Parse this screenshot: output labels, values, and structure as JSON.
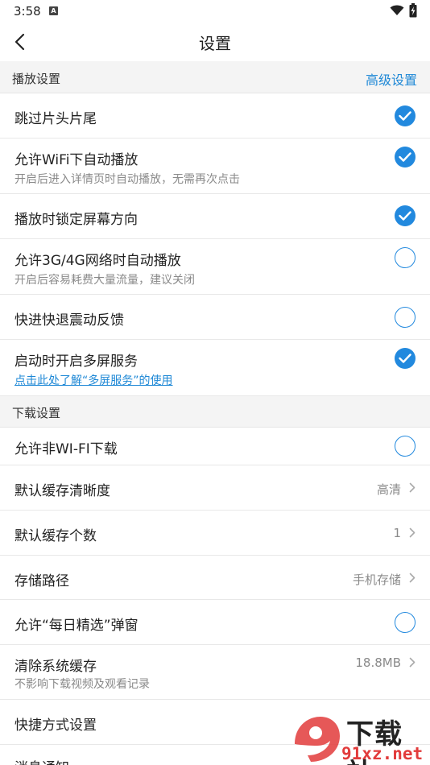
{
  "status": {
    "time": "3:58",
    "notif_letter": "A"
  },
  "header": {
    "title": "设置"
  },
  "sections": {
    "play": {
      "title": "播放设置",
      "link": "高级设置"
    },
    "download": {
      "title": "下载设置"
    }
  },
  "rows": {
    "skip_intro": {
      "title": "跳过片头片尾",
      "checked": true
    },
    "wifi_autoplay": {
      "title": "允许WiFi下自动播放",
      "sub": "开启后进入详情页时自动播放，无需再次点击",
      "checked": true
    },
    "lock_orientation": {
      "title": "播放时锁定屏幕方向",
      "checked": true
    },
    "mobile_autoplay": {
      "title": "允许3G/4G网络时自动播放",
      "sub": "开启后容易耗费大量流量，建议关闭",
      "checked": false
    },
    "seek_vibration": {
      "title": "快进快退震动反馈",
      "checked": false
    },
    "multiscreen": {
      "title": "启动时开启多屏服务",
      "link": "点击此处了解“多屏服务”的使用",
      "checked": true
    },
    "non_wifi_download": {
      "title": "允许非WI-FI下载",
      "checked": false
    },
    "cache_quality": {
      "title": "默认缓存清晰度",
      "value": "高清"
    },
    "cache_count": {
      "title": "默认缓存个数",
      "value": "1"
    },
    "storage_path": {
      "title": "存储路径",
      "value": "手机存储"
    },
    "daily_popup": {
      "title": "允许“每日精选”弹窗",
      "checked": false
    },
    "clear_cache": {
      "title": "清除系统缓存",
      "sub": "不影响下载视频及观看记录",
      "value": "18.8MB"
    },
    "shortcut": {
      "title": "快捷方式设置"
    },
    "notifications": {
      "title": "消息通知"
    }
  },
  "watermark": {
    "text_cn": "下载站",
    "text_url": "91xz.net"
  },
  "colors": {
    "accent": "#2289de",
    "section_bg": "#f4f4f4",
    "watermark_red": "#e23b3b"
  }
}
